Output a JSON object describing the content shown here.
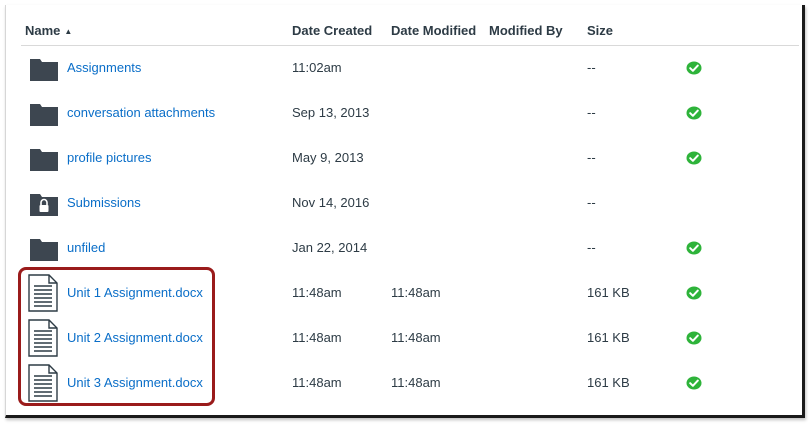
{
  "columns": {
    "name": "Name",
    "date_created": "Date Created",
    "date_modified": "Date Modified",
    "modified_by": "Modified By",
    "size": "Size"
  },
  "colors": {
    "link": "#0a6ec8",
    "folder": "#3d4650",
    "published": "#2eb33a",
    "highlight": "#9a1b1b"
  },
  "rows": [
    {
      "icon": "folder-icon",
      "name": "Assignments",
      "date_created": "11:02am",
      "date_modified": "",
      "modified_by": "",
      "size": "--",
      "published": true
    },
    {
      "icon": "folder-icon",
      "name": "conversation attachments",
      "date_created": "Sep 13, 2013",
      "date_modified": "",
      "modified_by": "",
      "size": "--",
      "published": true
    },
    {
      "icon": "folder-icon",
      "name": "profile pictures",
      "date_created": "May 9, 2013",
      "date_modified": "",
      "modified_by": "",
      "size": "--",
      "published": true
    },
    {
      "icon": "locked-folder-icon",
      "name": "Submissions",
      "date_created": "Nov 14, 2016",
      "date_modified": "",
      "modified_by": "",
      "size": "--",
      "published": false
    },
    {
      "icon": "folder-icon",
      "name": "unfiled",
      "date_created": "Jan 22, 2014",
      "date_modified": "",
      "modified_by": "",
      "size": "--",
      "published": true
    },
    {
      "icon": "document-icon",
      "name": "Unit 1 Assignment.docx",
      "date_created": "11:48am",
      "date_modified": "11:48am",
      "modified_by": "",
      "size": "161 KB",
      "published": true
    },
    {
      "icon": "document-icon",
      "name": "Unit 2 Assignment.docx",
      "date_created": "11:48am",
      "date_modified": "11:48am",
      "modified_by": "",
      "size": "161 KB",
      "published": true
    },
    {
      "icon": "document-icon",
      "name": "Unit 3 Assignment.docx",
      "date_created": "11:48am",
      "date_modified": "11:48am",
      "modified_by": "",
      "size": "161 KB",
      "published": true
    }
  ]
}
